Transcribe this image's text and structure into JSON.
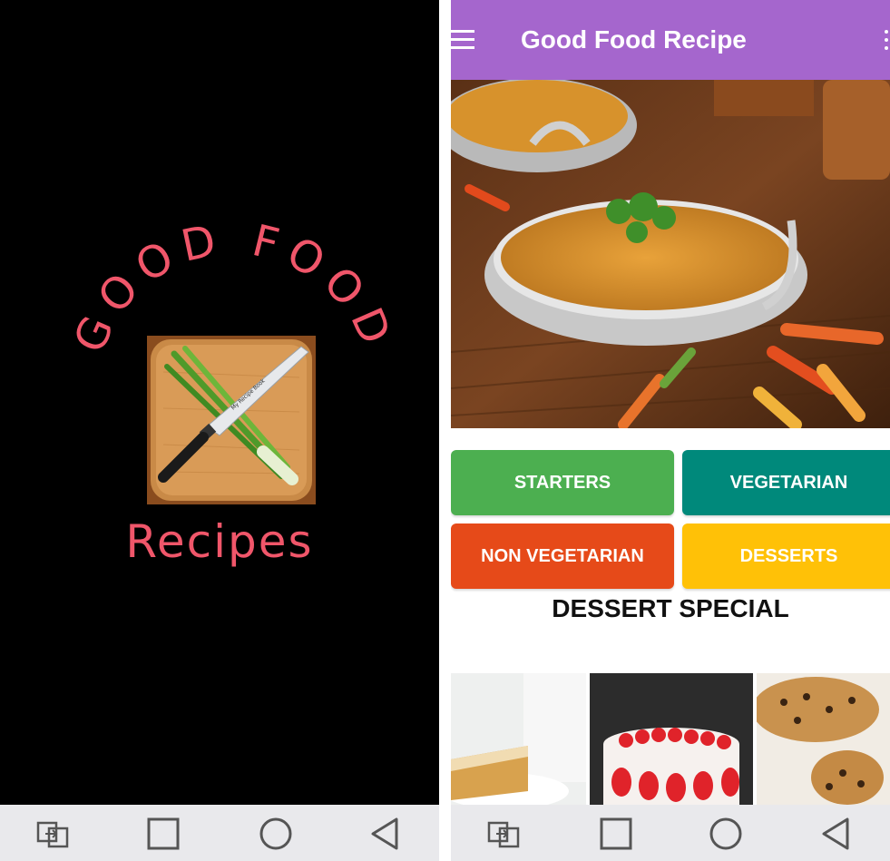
{
  "splash": {
    "brand_arc": "GOOD FOOD",
    "brand_sub": "Recipes",
    "knife_engraving": "My Recipe Book",
    "text_color": "#f0566a"
  },
  "app": {
    "title": "Good Food Recipe",
    "appbar_color": "#a566cd",
    "icons": {
      "menu": "hamburger-menu-icon",
      "overflow": "more-vertical-icon"
    },
    "hero_image": "curry-dish-image",
    "categories": [
      {
        "label": "STARTERS",
        "color": "#4caf50"
      },
      {
        "label": "VEGETARIAN",
        "color": "#00897b"
      },
      {
        "label": "NON VEGETARIAN",
        "color": "#e64a19"
      },
      {
        "label": "DESSERTS",
        "color": "#ffc107"
      }
    ],
    "section_title": "DESSERT SPECIAL",
    "thumbnails": [
      "pie-slice-image",
      "strawberry-cake-image",
      "cookie-cake-image"
    ]
  },
  "navbar": {
    "icons": [
      "app-switch-icon",
      "recent-apps-icon",
      "home-icon",
      "back-icon"
    ]
  }
}
